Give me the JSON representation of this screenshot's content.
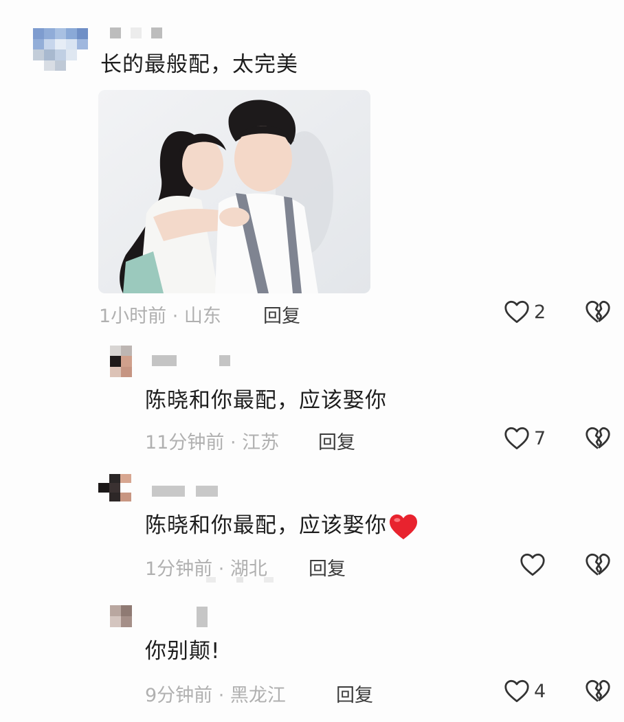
{
  "comments": [
    {
      "text": "长的最般配，太完美",
      "meta": "1小时前 · 山东",
      "reply_label": "回复",
      "likes": "2"
    },
    {
      "text": "陈晓和你最配，应该娶你",
      "meta": "11分钟前 · 江苏",
      "reply_label": "回复",
      "likes": "7"
    },
    {
      "text": "陈晓和你最配，应该娶你",
      "meta": "1分钟前 · 湖北",
      "reply_label": "回复",
      "likes": ""
    },
    {
      "text": "你别颠!",
      "meta": "9分钟前 · 黑龙江",
      "reply_label": "回复",
      "likes": "4"
    }
  ],
  "icons": {
    "like": "heart-outline-icon",
    "dislike": "broken-heart-icon",
    "emoji": "red-heart-emoji"
  },
  "colors": {
    "background": "#fdfdfd",
    "meta_text": "#b0b0b0",
    "emoji_heart": "#e8232e"
  }
}
